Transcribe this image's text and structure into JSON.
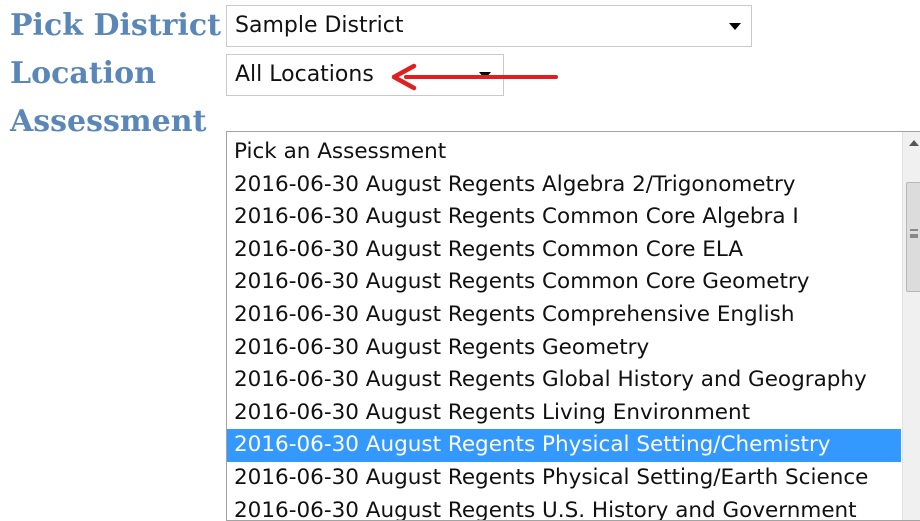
{
  "labels": {
    "district": "Pick District",
    "location": "Location",
    "assessment": "Assessment"
  },
  "district_select": {
    "value": "Sample District"
  },
  "location_select": {
    "value": "All Locations"
  },
  "assessment_list": {
    "selected_index": 9,
    "items": [
      "Pick an Assessment",
      "2016-06-30 August Regents Algebra 2/Trigonometry",
      "2016-06-30 August Regents Common Core Algebra I",
      "2016-06-30 August Regents Common Core ELA",
      "2016-06-30 August Regents Common Core Geometry",
      "2016-06-30 August Regents Comprehensive English",
      "2016-06-30 August Regents Geometry",
      "2016-06-30 August Regents Global History and Geography",
      "2016-06-30 August Regents Living Environment",
      "2016-06-30 August Regents Physical Setting/Chemistry",
      "2016-06-30 August Regents Physical Setting/Earth Science",
      "2016-06-30 August Regents U.S. History and Government"
    ]
  },
  "colors": {
    "label": "#5b87b8",
    "selection": "#3399ff",
    "annotation_arrow": "#e02020"
  },
  "icons": {
    "dropdown": "chevron-down-icon",
    "annotation": "red-arrow-icon"
  }
}
